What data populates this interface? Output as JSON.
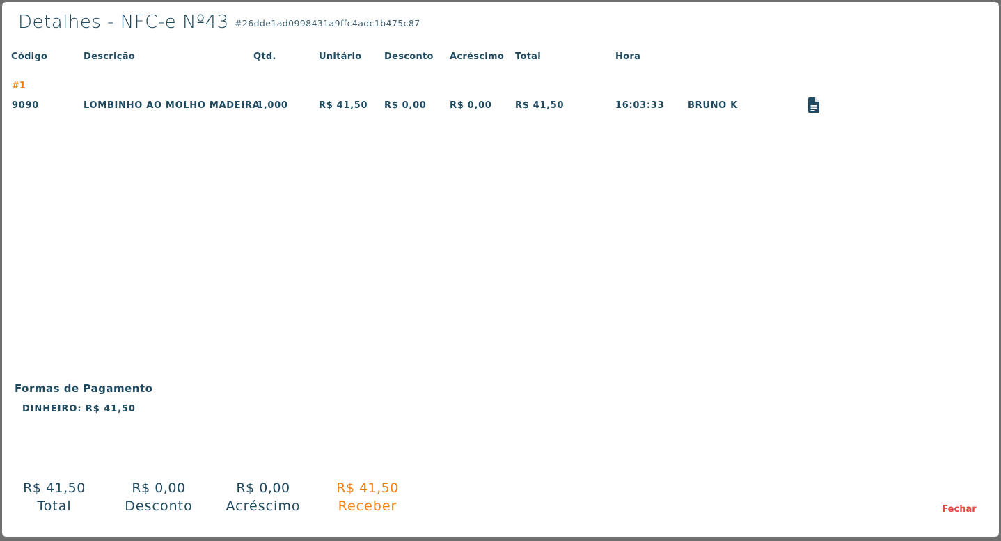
{
  "modal": {
    "title": "Detalhes - NFC-e Nº43",
    "hash": "#26dde1ad0998431a9ffc4adc1b475c87"
  },
  "table": {
    "headers": {
      "codigo": "Código",
      "descricao": "Descrição",
      "qtd": "Qtd.",
      "unitario": "Unitário",
      "desconto": "Desconto",
      "acrescimo": "Acréscimo",
      "total": "Total",
      "hora": "Hora"
    },
    "items": [
      {
        "seq": "#1",
        "codigo": "9090",
        "descricao": "LOMBINHO AO MOLHO MADEIRA",
        "qtd": "1,000",
        "unitario": "R$ 41,50",
        "desconto": "R$ 0,00",
        "acrescimo": "R$ 0,00",
        "total": "R$ 41,50",
        "hora": "16:03:33",
        "usuario": "BRUNO K",
        "icon": "file-text-icon"
      }
    ]
  },
  "payments": {
    "title": "Formas de Pagamento",
    "items": [
      "DINHEIRO: R$ 41,50"
    ]
  },
  "summary": {
    "total": {
      "value": "R$ 41,50",
      "label": "Total"
    },
    "desconto": {
      "value": "R$ 0,00",
      "label": "Desconto"
    },
    "acrescimo": {
      "value": "R$ 0,00",
      "label": "Acréscimo"
    },
    "receber": {
      "value": "R$ 41,50",
      "label": "Receber"
    }
  },
  "actions": {
    "close_label": "Fechar"
  },
  "colors": {
    "primary": "#1f4a5f",
    "accent": "#f07f10",
    "danger": "#e2453d"
  }
}
